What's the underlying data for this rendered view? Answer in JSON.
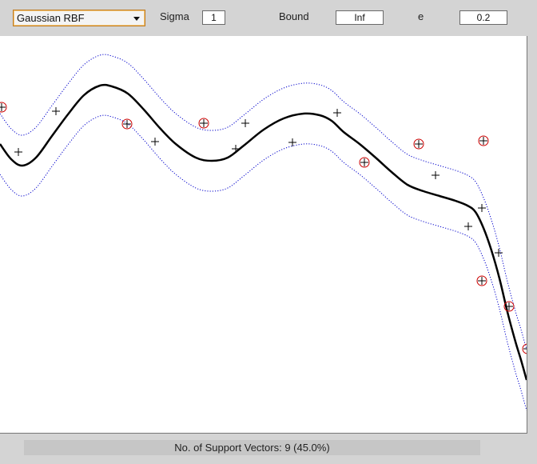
{
  "toolbar": {
    "kernel_select": {
      "value": "Gaussian RBF"
    },
    "sigma": {
      "label": "Sigma",
      "value": "1"
    },
    "bound": {
      "label": "Bound",
      "value": "Inf"
    },
    "e": {
      "label": "e",
      "value": "0.2"
    }
  },
  "status": {
    "text": "No. of Support Vectors: 9 (45.0%)"
  },
  "colors": {
    "curve": "#000000",
    "tube": "#0000cc",
    "support_vector_circle": "#cc0000",
    "point": "#000000"
  },
  "chart_data": {
    "type": "line",
    "title": "",
    "xlabel": "",
    "ylabel": "",
    "xlim": [
      0,
      659
    ],
    "ylim": [
      -496,
      0
    ],
    "epsilon": 0.2,
    "regression_curve": {
      "x": [
        0,
        14,
        28,
        45,
        65,
        85,
        105,
        125,
        140,
        160,
        180,
        200,
        220,
        245,
        265,
        285,
        305,
        330,
        355,
        380,
        400,
        415,
        430,
        450,
        470,
        490,
        510,
        530,
        550,
        570,
        585,
        595,
        605,
        615,
        625,
        635,
        645,
        652,
        659
      ],
      "y": [
        -135,
        -154,
        -162,
        -152,
        -125,
        -98,
        -74,
        -62,
        -63,
        -72,
        -92,
        -115,
        -135,
        -152,
        -156,
        -152,
        -137,
        -117,
        -103,
        -97,
        -99,
        -106,
        -120,
        -135,
        -152,
        -170,
        -186,
        -194,
        -200,
        -206,
        -212,
        -220,
        -240,
        -268,
        -303,
        -345,
        -382,
        -405,
        -430
      ]
    },
    "tube_offset": 38,
    "points": [
      {
        "x": 2,
        "y": -89,
        "support_vector": true
      },
      {
        "x": 23,
        "y": -145,
        "support_vector": false
      },
      {
        "x": 70,
        "y": -94,
        "support_vector": false
      },
      {
        "x": 159,
        "y": -110,
        "support_vector": true
      },
      {
        "x": 194,
        "y": -132,
        "support_vector": false
      },
      {
        "x": 255,
        "y": -109,
        "support_vector": true
      },
      {
        "x": 307,
        "y": -109,
        "support_vector": false
      },
      {
        "x": 295,
        "y": -141,
        "support_vector": false
      },
      {
        "x": 366,
        "y": -133,
        "support_vector": false
      },
      {
        "x": 422,
        "y": -96,
        "support_vector": false
      },
      {
        "x": 456,
        "y": -158,
        "support_vector": true
      },
      {
        "x": 524,
        "y": -135,
        "support_vector": true
      },
      {
        "x": 545,
        "y": -174,
        "support_vector": false
      },
      {
        "x": 605,
        "y": -131,
        "support_vector": true
      },
      {
        "x": 603,
        "y": -215,
        "support_vector": false
      },
      {
        "x": 586,
        "y": -238,
        "support_vector": false
      },
      {
        "x": 624,
        "y": -271,
        "support_vector": false
      },
      {
        "x": 603,
        "y": -306,
        "support_vector": true
      },
      {
        "x": 637,
        "y": -338,
        "support_vector": true
      },
      {
        "x": 660,
        "y": -391,
        "support_vector": true
      }
    ]
  }
}
